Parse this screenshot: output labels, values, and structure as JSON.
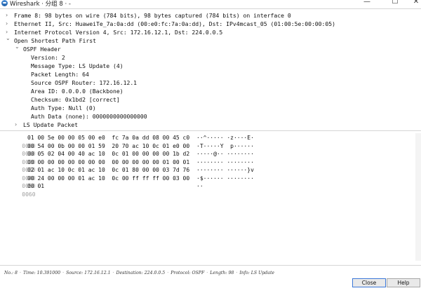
{
  "window": {
    "title": "Wireshark · 分组 8 · -",
    "minimize": "—",
    "maximize": "☐",
    "close": "✕"
  },
  "tree": [
    {
      "text": "Frame 8: 98 bytes on wire (784 bits), 98 bytes captured (784 bits) on interface 0",
      "arrow": "›"
    },
    {
      "text": "Ethernet II, Src: HuaweiTe_7a:0a:dd (00:e0:fc:7a:0a:dd), Dst: IPv4mcast_05 (01:00:5e:00:00:05)",
      "arrow": "›"
    },
    {
      "text": "Internet Protocol Version 4, Src: 172.16.12.1, Dst: 224.0.0.5",
      "arrow": "›"
    },
    {
      "text": "Open Shortest Path First",
      "arrow": "⌄"
    },
    {
      "text": "OSPF Header",
      "arrow": "⌄"
    },
    {
      "text": "Version: 2",
      "arrow": ""
    },
    {
      "text": "Message Type: LS Update (4)",
      "arrow": ""
    },
    {
      "text": "Packet Length: 64",
      "arrow": ""
    },
    {
      "text": "Source OSPF Router: 172.16.12.1",
      "arrow": ""
    },
    {
      "text": "Area ID: 0.0.0.0 (Backbone)",
      "arrow": ""
    },
    {
      "text": "Checksum: 0x1bd2 [correct]",
      "arrow": ""
    },
    {
      "text": "Auth Type: Null (0)",
      "arrow": ""
    },
    {
      "text": "Auth Data (none): 0000000000000000",
      "arrow": ""
    },
    {
      "text": "LS Update Packet",
      "arrow": "›"
    }
  ],
  "hex": [
    {
      "offset": "0000",
      "bytes": "01 00 5e 00 00 05 00 e0  fc 7a 0a dd 08 00 45 c0",
      "ascii": "··^····· ·z····E·"
    },
    {
      "offset": "0010",
      "bytes": "00 54 00 0b 00 00 01 59  20 70 ac 10 0c 01 e0 00",
      "ascii": "·T·····Y  p······"
    },
    {
      "offset": "0020",
      "bytes": "00 05 02 04 00 40 ac 10  0c 01 00 00 00 00 1b d2",
      "ascii": "·····@·· ········"
    },
    {
      "offset": "0030",
      "bytes": "00 00 00 00 00 00 00 00  00 00 00 00 00 01 00 01",
      "ascii": "········ ········"
    },
    {
      "offset": "0040",
      "bytes": "02 01 ac 10 0c 01 ac 10  0c 01 80 00 00 03 7d 76",
      "ascii": "········ ······}v"
    },
    {
      "offset": "0050",
      "bytes": "00 24 00 00 00 01 ac 10  0c 00 ff ff ff 00 03 00",
      "ascii": "·$······ ········"
    },
    {
      "offset": "0060",
      "bytes": "00 01",
      "ascii": "··"
    }
  ],
  "status": {
    "no": "No.: 8",
    "time": "Time: 10.391000",
    "source": "Source: 172.16.12.1",
    "destination": "Destination: 224.0.0.5",
    "protocol": "Protocol: OSPF",
    "length": "Length: 98",
    "info": "Info: LS Update",
    "dot": "·"
  },
  "buttons": {
    "close": "Close",
    "help": "Help"
  }
}
